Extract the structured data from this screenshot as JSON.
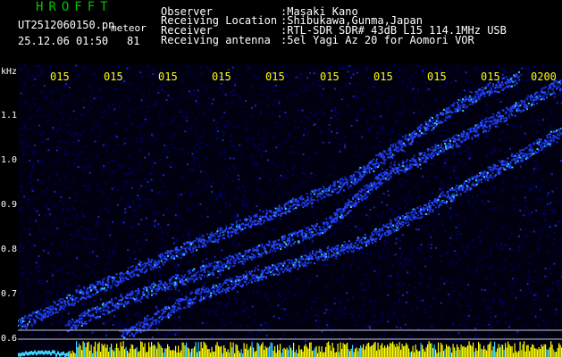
{
  "header": {
    "title": "HROFFT",
    "filename": "UT2512060150.pn",
    "mode": "meteor",
    "datetime": "25.12.06 01:50",
    "count": "81"
  },
  "info": [
    {
      "label": "Observer",
      "value": ":Masaki Kano"
    },
    {
      "label": "Receiving Location",
      "value": ":Shibukawa,Gunma,Japan"
    },
    {
      "label": "Receiver",
      "value": ":RTL-SDR SDR# 43dB L15 114.1MHz USB"
    },
    {
      "label": "Receiving antenna",
      "value": ":5el Yagi Az 20 for Aomori VOR"
    }
  ],
  "axis": {
    "unit": "kHz",
    "y_ticks": [
      "1.1",
      "1.0",
      "0.9",
      "0.8",
      "0.7",
      "0.6"
    ],
    "x_ticks": [
      "015",
      "015",
      "015",
      "015",
      "015",
      "015",
      "015",
      "015",
      "015",
      "0200"
    ]
  },
  "colors": {
    "background": "#000000",
    "noise": "#00006e",
    "signal": "#2a48ff",
    "signal_hot": "#38d0ff",
    "burst": "#ffff00",
    "title": "#00c400"
  }
}
